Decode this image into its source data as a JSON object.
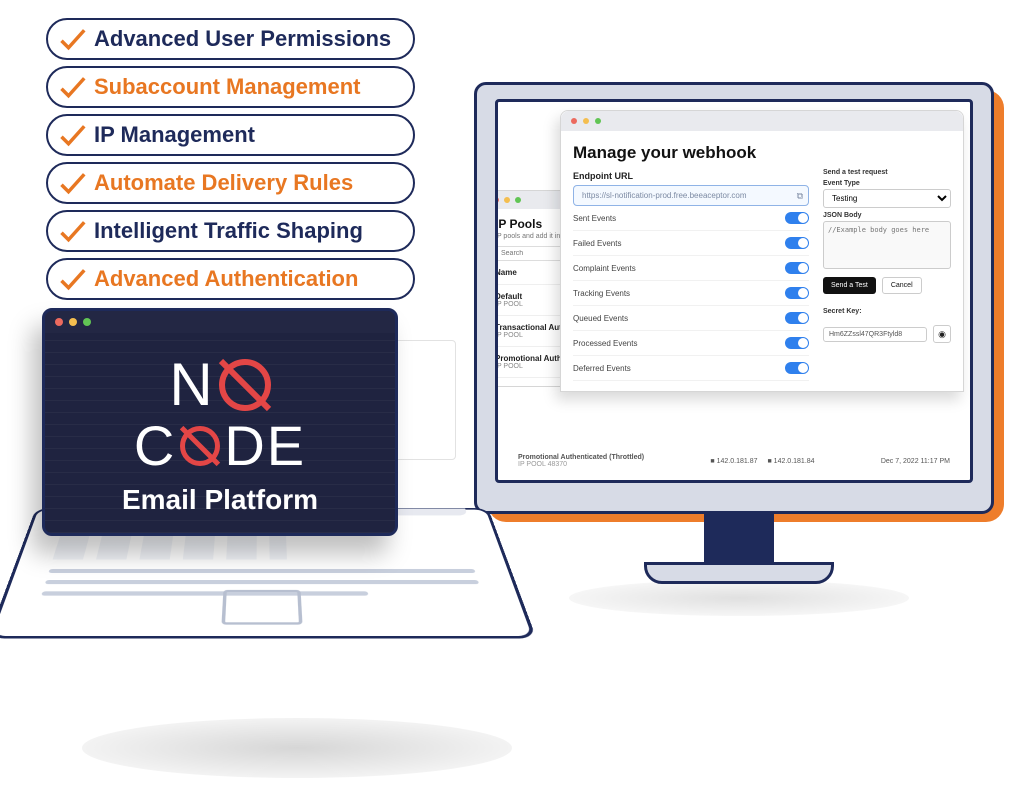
{
  "features": [
    {
      "label": "Advanced User Permissions",
      "emphasis": "navy"
    },
    {
      "label": "Subaccount Management",
      "emphasis": "orange"
    },
    {
      "label": "IP Management",
      "emphasis": "navy"
    },
    {
      "label": "Automate Delivery Rules",
      "emphasis": "orange"
    },
    {
      "label": "Intelligent Traffic Shaping",
      "emphasis": "navy"
    },
    {
      "label": "Advanced Authentication",
      "emphasis": "orange"
    }
  ],
  "laptop": {
    "no_line": "NO",
    "code_line": "CODE",
    "tagline": "Email Platform"
  },
  "ip_pools_window": {
    "title": "IP Pools",
    "blurb": "IP pools and add it into our",
    "search_placeholder": "Search",
    "name_header": "Name",
    "rows": [
      {
        "name": "Default",
        "sub": "IP POOL"
      },
      {
        "name": "Transactional Authenticated",
        "sub": "IP POOL"
      },
      {
        "name": "Promotional Authenticated",
        "sub": "IP POOL"
      }
    ],
    "footer": {
      "name": "Promotional Authenticated (Throttled)",
      "sub": "IP POOL 48370",
      "ips": [
        "142.0.181.87",
        "142.0.181.84"
      ],
      "timestamp": "Dec 7, 2022 11:17 PM"
    }
  },
  "webhook_window": {
    "title": "Manage your webhook",
    "endpoint_label": "Endpoint URL",
    "endpoint_value": "https://sl-notification-prod.free.beeaceptor.com",
    "event_rows": [
      "Sent Events",
      "Failed Events",
      "Complaint Events",
      "Tracking Events",
      "Queued Events",
      "Processed Events",
      "Deferred Events"
    ],
    "side": {
      "send_test_heading": "Send a test request",
      "event_type_label": "Event Type",
      "event_type_value": "Testing",
      "json_body_label": "JSON Body",
      "json_body_placeholder": "//Example body goes here",
      "send_test_btn": "Send a Test",
      "cancel_btn": "Cancel",
      "secret_label": "Secret Key:",
      "secret_value": "Hm6ZZssl47QR3Ftyld8"
    }
  },
  "colors": {
    "navy": "#1e2a5a",
    "orange": "#e87722",
    "blue_toggle": "#2f80ed"
  }
}
